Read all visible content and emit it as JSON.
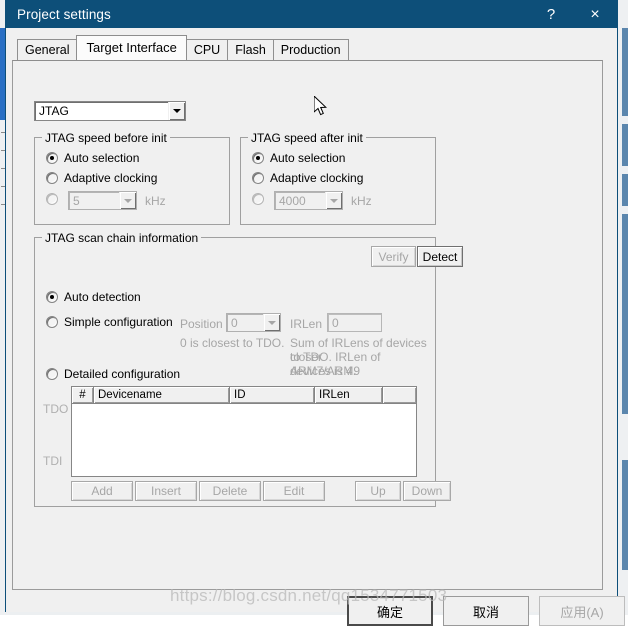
{
  "window": {
    "title": "Project settings",
    "help_label": "?",
    "close_label": "×",
    "titlebar_color": "#0d4f79"
  },
  "tabs": [
    {
      "label": "General",
      "active": false
    },
    {
      "label": "Target Interface",
      "active": true
    },
    {
      "label": "CPU",
      "active": false
    },
    {
      "label": "Flash",
      "active": false
    },
    {
      "label": "Production",
      "active": false
    }
  ],
  "interface_select": {
    "value": "JTAG",
    "arrow_icon": "chevron-down-icon"
  },
  "speed_before_init": {
    "legend": "JTAG speed before init",
    "options": [
      {
        "label": "Auto selection",
        "selected": true,
        "disabled": false
      },
      {
        "label": "Adaptive clocking",
        "selected": false,
        "disabled": false
      },
      {
        "label": "",
        "selected": false,
        "disabled": true
      }
    ],
    "speed_value": "5",
    "unit": "kHz"
  },
  "speed_after_init": {
    "legend": "JTAG speed after init",
    "options": [
      {
        "label": "Auto selection",
        "selected": true,
        "disabled": false
      },
      {
        "label": "Adaptive clocking",
        "selected": false,
        "disabled": false
      },
      {
        "label": "",
        "selected": false,
        "disabled": true
      }
    ],
    "speed_value": "4000",
    "unit": "kHz"
  },
  "scan_chain": {
    "legend": "JTAG scan chain information",
    "verify_label": "Verify",
    "detect_label": "Detect",
    "auto_detection_label": "Auto detection",
    "simple_configuration_label": "Simple configuration",
    "detailed_configuration_label": "Detailed configuration",
    "position_label": "Position",
    "position_value": "0",
    "position_hint": "0 is closest to TDO.",
    "irlen_label": "IRLen",
    "irlen_value": "0",
    "irlen_hint_line1": "Sum of IRLens of devices closer",
    "irlen_hint_line2": "to TDO. IRLen of ARM7/ARM9",
    "irlen_hint_line3": "devices is 4.",
    "tdo_label": "TDO",
    "tdi_label": "TDI",
    "table": {
      "columns": [
        "#",
        "Devicename",
        "ID",
        "IRLen",
        ""
      ],
      "rows": []
    },
    "buttons": [
      {
        "label": "Add",
        "disabled": true
      },
      {
        "label": "Insert",
        "disabled": true
      },
      {
        "label": "Delete",
        "disabled": true
      },
      {
        "label": "Edit",
        "disabled": true
      },
      {
        "label": "Up",
        "disabled": true
      },
      {
        "label": "Down",
        "disabled": true
      }
    ]
  },
  "footer": {
    "ok_label": "确定",
    "cancel_label": "取消",
    "apply_label": "应用(A)"
  },
  "watermark": {
    "text": "https://blog.csdn.net/qq1534771503"
  }
}
